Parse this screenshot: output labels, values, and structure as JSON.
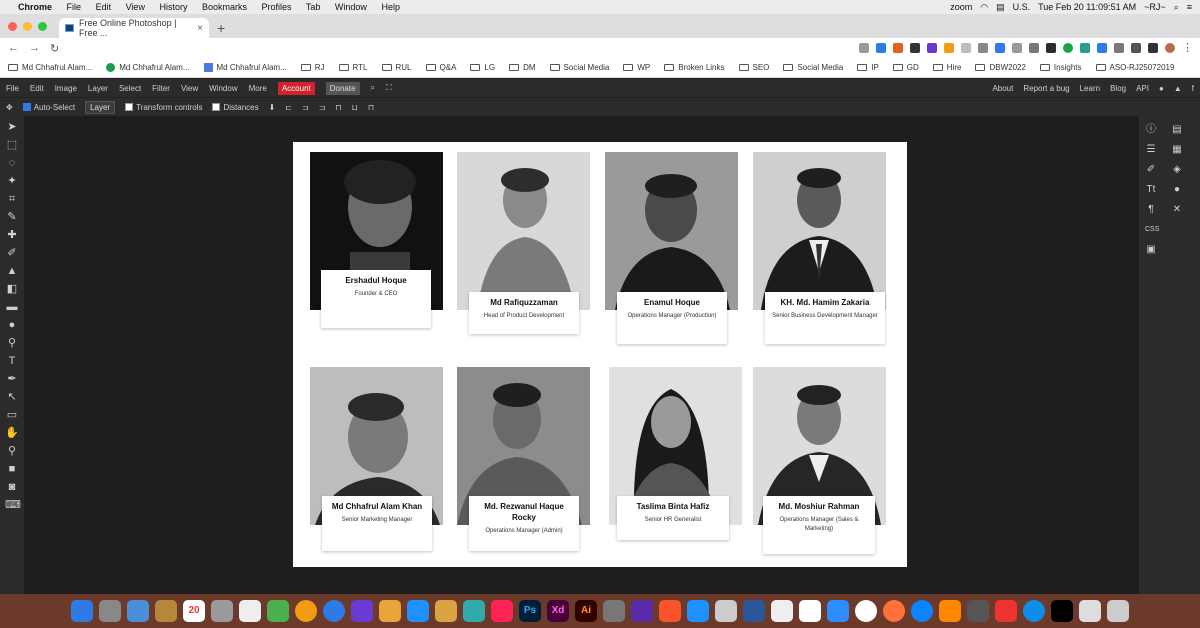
{
  "mac_menu": {
    "app": "Chrome",
    "items": [
      "File",
      "Edit",
      "View",
      "History",
      "Bookmarks",
      "Profiles",
      "Tab",
      "Window",
      "Help"
    ],
    "status": {
      "zoom": "zoom",
      "locale": "U.S.",
      "datetime": "Tue Feb 20  11:09:51 AM",
      "user": "~RJ~"
    }
  },
  "browser": {
    "tab_title": "Free Online Photoshop | Free ...",
    "tab_close": "×",
    "new_tab": "+",
    "bookmarks": [
      "Md Chhafrul Alam...",
      "Md Chhafrul Alam...",
      "Md Chhafrul Alam...",
      "RJ",
      "RTL",
      "RUL",
      "Q&A",
      "LG",
      "DM",
      "Social Media",
      "WP",
      "Broken Links",
      "SEO",
      "Social Media",
      "IP",
      "GD",
      "Hire",
      "DBW2022",
      "Insights",
      "ASO-RJ25072019"
    ]
  },
  "photopea": {
    "menu": [
      "File",
      "Edit",
      "Image",
      "Layer",
      "Select",
      "Filter",
      "View",
      "Window",
      "More"
    ],
    "account": "Account",
    "donate": "Donate",
    "right_links": [
      "About",
      "Report a bug",
      "Learn",
      "Blog",
      "API"
    ],
    "options": {
      "auto_select": "Auto-Select",
      "layer_select": "Layer",
      "transform": "Transform controls",
      "distances": "Distances"
    }
  },
  "team": [
    {
      "name": "Ershadul Hoque",
      "role": "Founder & CEO"
    },
    {
      "name": "Md Rafiquzzaman",
      "role": "Head of Product Development"
    },
    {
      "name": "Enamul Hoque",
      "role": "Operations Manager (Production)"
    },
    {
      "name": "KH. Md. Hamim Zakaria",
      "role": "Senior Business Development Manager"
    },
    {
      "name": "Md Chhafrul Alam Khan",
      "role": "Senior Marketing Manager"
    },
    {
      "name": "Md. Rezwanul Haque Rocky",
      "role": "Operations Manager (Admin)"
    },
    {
      "name": "Taslima Binta Hafiz",
      "role": "Senior HR Generalist"
    },
    {
      "name": "Md. Moshiur Rahman",
      "role": "Operations Manager (Sales & Marketing)"
    }
  ],
  "dock_calendar_day": "20",
  "colors": {
    "account_red": "#d2222d",
    "panel_bg": "#2b2b2b",
    "canvas_bg": "#1e1e1e"
  }
}
